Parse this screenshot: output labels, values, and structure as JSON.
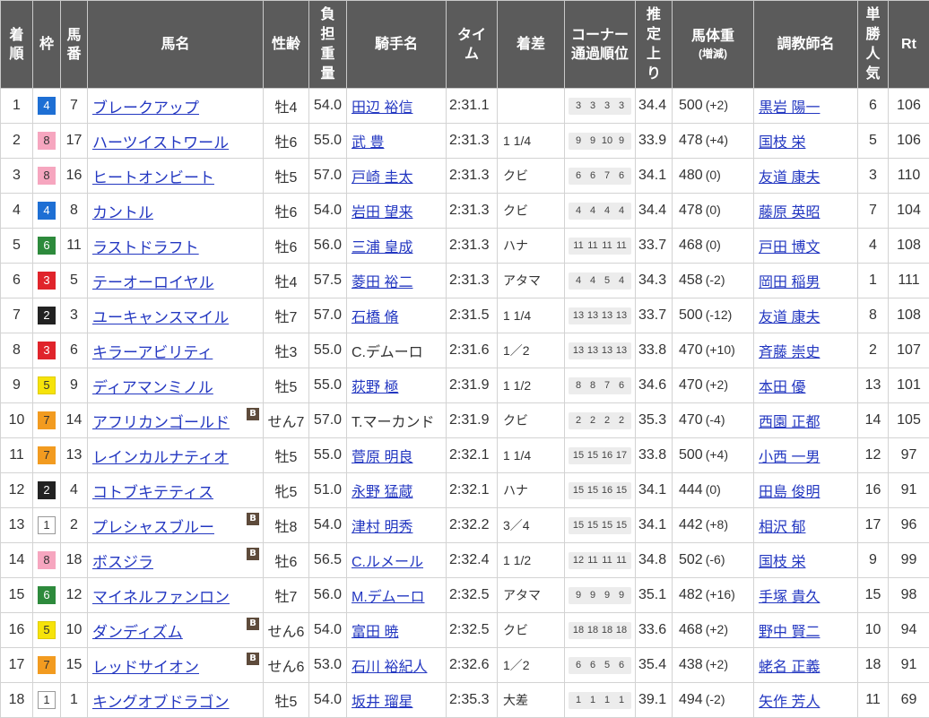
{
  "colors": {
    "header_bg": "#5b5b5b",
    "header_text": "#ffffff",
    "header_border": "#c9c9c9",
    "text": "#333333",
    "border": "#d3d3d3",
    "link": "#2337c1",
    "blinker_bg": "#5e4b3b",
    "blinker_text": "#ffffff",
    "corner_bg": "#ececec"
  },
  "waku_colors": {
    "1": {
      "bg": "#ffffff",
      "fg": "#333333",
      "border": "#999999"
    },
    "2": {
      "bg": "#222222",
      "fg": "#ffffff",
      "border": "#222222"
    },
    "3": {
      "bg": "#e0242b",
      "fg": "#ffffff",
      "border": "#e0242b"
    },
    "4": {
      "bg": "#1e6fd4",
      "fg": "#ffffff",
      "border": "#1e6fd4"
    },
    "5": {
      "bg": "#f6e30a",
      "fg": "#333333",
      "border": "#e0cc00"
    },
    "6": {
      "bg": "#2d8a3c",
      "fg": "#ffffff",
      "border": "#2d8a3c"
    },
    "7": {
      "bg": "#f29b20",
      "fg": "#333333",
      "border": "#f29b20"
    },
    "8": {
      "bg": "#f6a6bf",
      "fg": "#333333",
      "border": "#f6a6bf"
    }
  },
  "blinker_label": "B",
  "headers": [
    {
      "label": "着\n順"
    },
    {
      "label": "枠"
    },
    {
      "label": "馬\n番"
    },
    {
      "label": "馬名"
    },
    {
      "label": "性齢"
    },
    {
      "label": "負\n担\n重\n量"
    },
    {
      "label": "騎手名"
    },
    {
      "label": "タイ\nム"
    },
    {
      "label": "着差"
    },
    {
      "label": "コーナー\n通過順位"
    },
    {
      "label": "推\n定\n上\nり"
    },
    {
      "label": "馬体重",
      "sub": "(増減)"
    },
    {
      "label": "調教師名"
    },
    {
      "label": "単\n勝\n人\n気"
    },
    {
      "label": "Rt"
    }
  ],
  "rows": [
    {
      "rank": "1",
      "waku": "4",
      "num": "7",
      "name": "ブレークアップ",
      "blinker": false,
      "sex_age": "牡4",
      "weight": "54.0",
      "jockey": "田辺 裕信",
      "jockey_link": true,
      "time": "2:31.1",
      "margin": "",
      "corners": [
        "3",
        "3",
        "3",
        "3"
      ],
      "last3f": "34.4",
      "body_weight": "500",
      "body_diff": "(+2)",
      "trainer": "黒岩 陽一",
      "pop": "6",
      "rt": "106"
    },
    {
      "rank": "2",
      "waku": "8",
      "num": "17",
      "name": "ハーツイストワール",
      "blinker": false,
      "sex_age": "牡6",
      "weight": "55.0",
      "jockey": "武 豊",
      "jockey_link": true,
      "time": "2:31.3",
      "margin": "1 1/4",
      "corners": [
        "9",
        "9",
        "10",
        "9"
      ],
      "last3f": "33.9",
      "body_weight": "478",
      "body_diff": "(+4)",
      "trainer": "国枝 栄",
      "pop": "5",
      "rt": "106"
    },
    {
      "rank": "3",
      "waku": "8",
      "num": "16",
      "name": "ヒートオンビート",
      "blinker": false,
      "sex_age": "牡5",
      "weight": "57.0",
      "jockey": "戸崎 圭太",
      "jockey_link": true,
      "time": "2:31.3",
      "margin": "クビ",
      "corners": [
        "6",
        "6",
        "7",
        "6"
      ],
      "last3f": "34.1",
      "body_weight": "480",
      "body_diff": "(0)",
      "trainer": "友道 康夫",
      "pop": "3",
      "rt": "110"
    },
    {
      "rank": "4",
      "waku": "4",
      "num": "8",
      "name": "カントル",
      "blinker": false,
      "sex_age": "牡6",
      "weight": "54.0",
      "jockey": "岩田 望来",
      "jockey_link": true,
      "time": "2:31.3",
      "margin": "クビ",
      "corners": [
        "4",
        "4",
        "4",
        "4"
      ],
      "last3f": "34.4",
      "body_weight": "478",
      "body_diff": "(0)",
      "trainer": "藤原 英昭",
      "pop": "7",
      "rt": "104"
    },
    {
      "rank": "5",
      "waku": "6",
      "num": "11",
      "name": "ラストドラフト",
      "blinker": false,
      "sex_age": "牡6",
      "weight": "56.0",
      "jockey": "三浦 皇成",
      "jockey_link": true,
      "time": "2:31.3",
      "margin": "ハナ",
      "corners": [
        "11",
        "11",
        "11",
        "11"
      ],
      "last3f": "33.7",
      "body_weight": "468",
      "body_diff": "(0)",
      "trainer": "戸田 博文",
      "pop": "4",
      "rt": "108"
    },
    {
      "rank": "6",
      "waku": "3",
      "num": "5",
      "name": "テーオーロイヤル",
      "blinker": false,
      "sex_age": "牡4",
      "weight": "57.5",
      "jockey": "菱田 裕二",
      "jockey_link": true,
      "time": "2:31.3",
      "margin": "アタマ",
      "corners": [
        "4",
        "4",
        "5",
        "4"
      ],
      "last3f": "34.3",
      "body_weight": "458",
      "body_diff": "(-2)",
      "trainer": "岡田 稲男",
      "pop": "1",
      "rt": "111"
    },
    {
      "rank": "7",
      "waku": "2",
      "num": "3",
      "name": "ユーキャンスマイル",
      "blinker": false,
      "sex_age": "牡7",
      "weight": "57.0",
      "jockey": "石橋 脩",
      "jockey_link": true,
      "time": "2:31.5",
      "margin": "1 1/4",
      "corners": [
        "13",
        "13",
        "13",
        "13"
      ],
      "last3f": "33.7",
      "body_weight": "500",
      "body_diff": "(-12)",
      "trainer": "友道 康夫",
      "pop": "8",
      "rt": "108"
    },
    {
      "rank": "8",
      "waku": "3",
      "num": "6",
      "name": "キラーアビリティ",
      "blinker": false,
      "sex_age": "牡3",
      "weight": "55.0",
      "jockey": "C.デムーロ",
      "jockey_link": false,
      "time": "2:31.6",
      "margin": "1／2",
      "corners": [
        "13",
        "13",
        "13",
        "13"
      ],
      "last3f": "33.8",
      "body_weight": "470",
      "body_diff": "(+10)",
      "trainer": "斉藤 崇史",
      "pop": "2",
      "rt": "107"
    },
    {
      "rank": "9",
      "waku": "5",
      "num": "9",
      "name": "ディアマンミノル",
      "blinker": false,
      "sex_age": "牡5",
      "weight": "55.0",
      "jockey": "荻野 極",
      "jockey_link": true,
      "time": "2:31.9",
      "margin": "1 1/2",
      "corners": [
        "8",
        "8",
        "7",
        "6"
      ],
      "last3f": "34.6",
      "body_weight": "470",
      "body_diff": "(+2)",
      "trainer": "本田 優",
      "pop": "13",
      "rt": "101"
    },
    {
      "rank": "10",
      "waku": "7",
      "num": "14",
      "name": "アフリカンゴールド",
      "blinker": true,
      "sex_age": "せん7",
      "weight": "57.0",
      "jockey": "T.マーカンド",
      "jockey_link": false,
      "time": "2:31.9",
      "margin": "クビ",
      "corners": [
        "2",
        "2",
        "2",
        "2"
      ],
      "last3f": "35.3",
      "body_weight": "470",
      "body_diff": "(-4)",
      "trainer": "西園 正都",
      "pop": "14",
      "rt": "105"
    },
    {
      "rank": "11",
      "waku": "7",
      "num": "13",
      "name": "レインカルナティオ",
      "blinker": false,
      "sex_age": "牡5",
      "weight": "55.0",
      "jockey": "菅原 明良",
      "jockey_link": true,
      "time": "2:32.1",
      "margin": "1 1/4",
      "corners": [
        "15",
        "15",
        "16",
        "17"
      ],
      "last3f": "33.8",
      "body_weight": "500",
      "body_diff": "(+4)",
      "trainer": "小西 一男",
      "pop": "12",
      "rt": "97"
    },
    {
      "rank": "12",
      "waku": "2",
      "num": "4",
      "name": "コトブキテティス",
      "blinker": false,
      "sex_age": "牝5",
      "weight": "51.0",
      "jockey": "永野 猛蔵",
      "jockey_link": true,
      "time": "2:32.1",
      "margin": "ハナ",
      "corners": [
        "15",
        "15",
        "16",
        "15"
      ],
      "last3f": "34.1",
      "body_weight": "444",
      "body_diff": "(0)",
      "trainer": "田島 俊明",
      "pop": "16",
      "rt": "91"
    },
    {
      "rank": "13",
      "waku": "1",
      "num": "2",
      "name": "プレシャスブルー",
      "blinker": true,
      "sex_age": "牡8",
      "weight": "54.0",
      "jockey": "津村 明秀",
      "jockey_link": true,
      "time": "2:32.2",
      "margin": "3／4",
      "corners": [
        "15",
        "15",
        "15",
        "15"
      ],
      "last3f": "34.1",
      "body_weight": "442",
      "body_diff": "(+8)",
      "trainer": "相沢 郁",
      "pop": "17",
      "rt": "96"
    },
    {
      "rank": "14",
      "waku": "8",
      "num": "18",
      "name": "ボスジラ",
      "blinker": true,
      "sex_age": "牡6",
      "weight": "56.5",
      "jockey": "C.ルメール",
      "jockey_link": true,
      "time": "2:32.4",
      "margin": "1 1/2",
      "corners": [
        "12",
        "11",
        "11",
        "11"
      ],
      "last3f": "34.8",
      "body_weight": "502",
      "body_diff": "(-6)",
      "trainer": "国枝 栄",
      "pop": "9",
      "rt": "99"
    },
    {
      "rank": "15",
      "waku": "6",
      "num": "12",
      "name": "マイネルファンロン",
      "blinker": false,
      "sex_age": "牡7",
      "weight": "56.0",
      "jockey": "M.デムーロ",
      "jockey_link": true,
      "time": "2:32.5",
      "margin": "アタマ",
      "corners": [
        "9",
        "9",
        "9",
        "9"
      ],
      "last3f": "35.1",
      "body_weight": "482",
      "body_diff": "(+16)",
      "trainer": "手塚 貴久",
      "pop": "15",
      "rt": "98"
    },
    {
      "rank": "16",
      "waku": "5",
      "num": "10",
      "name": "ダンディズム",
      "blinker": true,
      "sex_age": "せん6",
      "weight": "54.0",
      "jockey": "富田 暁",
      "jockey_link": true,
      "time": "2:32.5",
      "margin": "クビ",
      "corners": [
        "18",
        "18",
        "18",
        "18"
      ],
      "last3f": "33.6",
      "body_weight": "468",
      "body_diff": "(+2)",
      "trainer": "野中 賢二",
      "pop": "10",
      "rt": "94"
    },
    {
      "rank": "17",
      "waku": "7",
      "num": "15",
      "name": "レッドサイオン",
      "blinker": true,
      "sex_age": "せん6",
      "weight": "53.0",
      "jockey": "石川 裕紀人",
      "jockey_link": true,
      "time": "2:32.6",
      "margin": "1／2",
      "corners": [
        "6",
        "6",
        "5",
        "6"
      ],
      "last3f": "35.4",
      "body_weight": "438",
      "body_diff": "(+2)",
      "trainer": "蛯名 正義",
      "pop": "18",
      "rt": "91"
    },
    {
      "rank": "18",
      "waku": "1",
      "num": "1",
      "name": "キングオブドラゴン",
      "blinker": false,
      "sex_age": "牡5",
      "weight": "54.0",
      "jockey": "坂井 瑠星",
      "jockey_link": true,
      "time": "2:35.3",
      "margin": "大差",
      "corners": [
        "1",
        "1",
        "1",
        "1"
      ],
      "last3f": "39.1",
      "body_weight": "494",
      "body_diff": "(-2)",
      "trainer": "矢作 芳人",
      "pop": "11",
      "rt": "69"
    }
  ]
}
